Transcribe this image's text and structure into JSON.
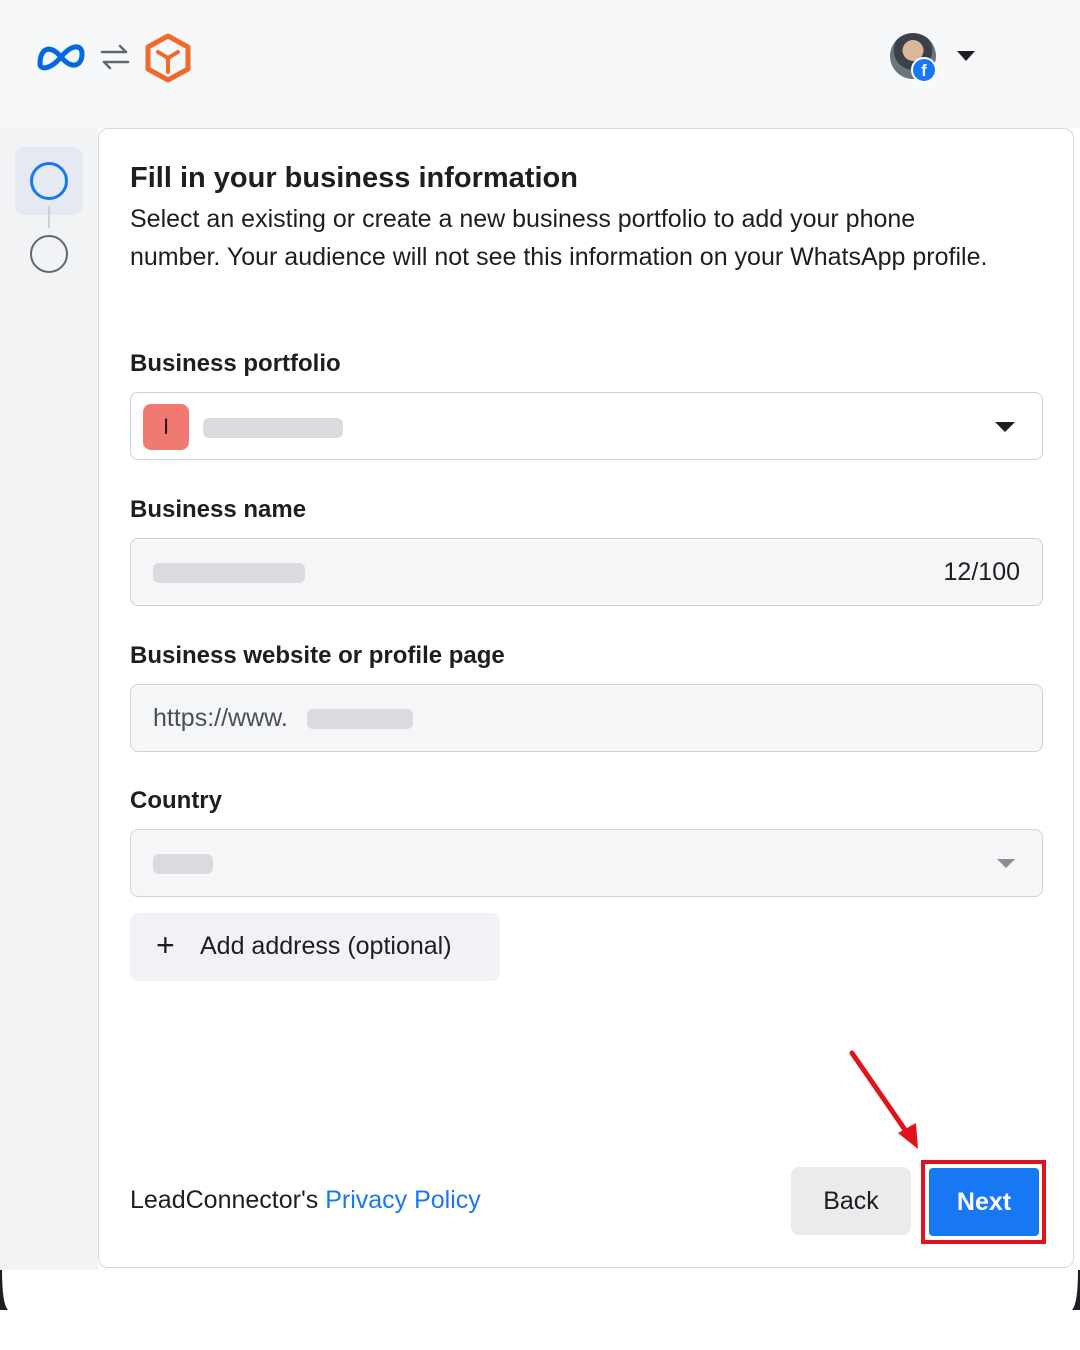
{
  "header": {
    "account_fb_badge": "f"
  },
  "form": {
    "title": "Fill in your business information",
    "subtitle": "Select an existing or create a new business portfolio to add your phone number. Your audience will not see this information on your WhatsApp profile.",
    "portfolio": {
      "label": "Business portfolio",
      "avatar_letter": "I"
    },
    "business_name": {
      "label": "Business name",
      "counter": "12/100"
    },
    "website": {
      "label": "Business website or profile page",
      "value": "https://www."
    },
    "country": {
      "label": "Country"
    },
    "add_address_label": "Add address (optional)",
    "add_address_icon": "+"
  },
  "footer": {
    "privacy_prefix": "LeadConnector's ",
    "privacy_link": "Privacy Policy",
    "back_label": "Back",
    "next_label": "Next"
  },
  "annotation": {
    "color": "#e0131b"
  },
  "colors": {
    "accent": "#1877f2",
    "brand_orange": "#f26a2a"
  }
}
